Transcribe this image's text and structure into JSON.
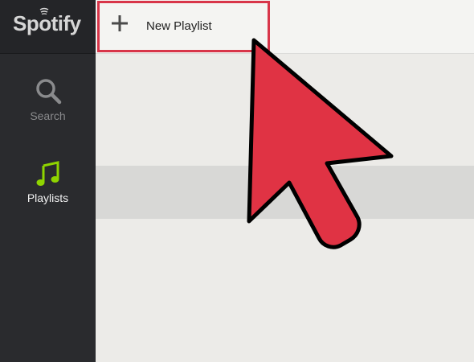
{
  "app": {
    "logo_text": "Spotify"
  },
  "sidebar": {
    "items": [
      {
        "label": "Search",
        "icon": "search-icon"
      },
      {
        "label": "Playlists",
        "icon": "music-note-icon"
      }
    ]
  },
  "toolbar": {
    "new_playlist_label": "New Playlist",
    "icon": "plus-icon"
  },
  "colors": {
    "sidebar_bg": "#2a2b2e",
    "highlight_border": "#d83549",
    "arrow_fill": "#e03344",
    "playlist_icon": "#8fd400"
  }
}
